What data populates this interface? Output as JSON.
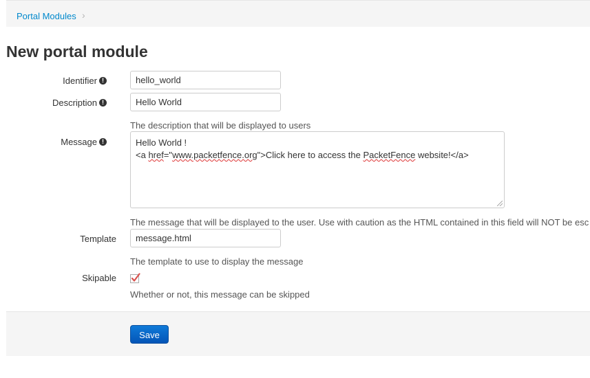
{
  "breadcrumb": {
    "link": "Portal Modules",
    "separator": "›"
  },
  "page_title": "New portal module",
  "form": {
    "identifier": {
      "label": "Identifier",
      "value": "hello_world"
    },
    "description": {
      "label": "Description",
      "value": "Hello World",
      "help": "The description that will be displayed to users"
    },
    "message": {
      "label": "Message",
      "line1": "Hello World !",
      "line2_a": "<a ",
      "line2_href": "href",
      "line2_b": "=\"",
      "line2_url": "www.packetfence.org",
      "line2_c": "\">Click here to access the ",
      "line2_brand": "PacketFence",
      "line2_d": " website!</a>",
      "help": "The message that will be displayed to the user. Use with caution as the HTML contained in this field will NOT be esc"
    },
    "template": {
      "label": "Template",
      "value": "message.html",
      "help": "The template to use to display the message"
    },
    "skipable": {
      "label": "Skipable",
      "checked": true,
      "help": "Whether or not, this message can be skipped"
    }
  },
  "actions": {
    "save_label": "Save"
  },
  "icons": {
    "info": "info-circle-icon",
    "check": "checkmark-icon",
    "chevron": "chevron-right-icon"
  },
  "colors": {
    "link": "#0088cc",
    "primary_button": "#0455b7",
    "check": "#d9534f"
  }
}
